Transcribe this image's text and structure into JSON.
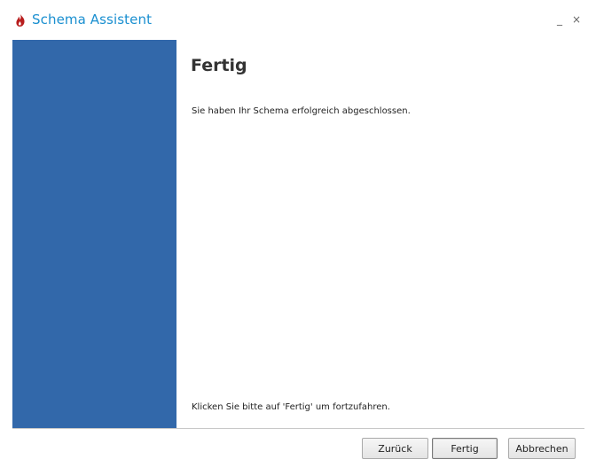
{
  "window": {
    "title": "Schema Assistent",
    "minimize_glyph": "_",
    "close_glyph": "×",
    "icon": "flame-icon",
    "accent_color": "#1a8fd0",
    "side_panel_color": "#3268aa"
  },
  "content": {
    "heading": "Fertig",
    "message": "Sie haben Ihr Schema erfolgreich abgeschlossen.",
    "hint": "Klicken Sie bitte auf 'Fertig' um fortzufahren."
  },
  "buttons": {
    "back": "Zurück",
    "finish": "Fertig",
    "cancel": "Abbrechen"
  }
}
